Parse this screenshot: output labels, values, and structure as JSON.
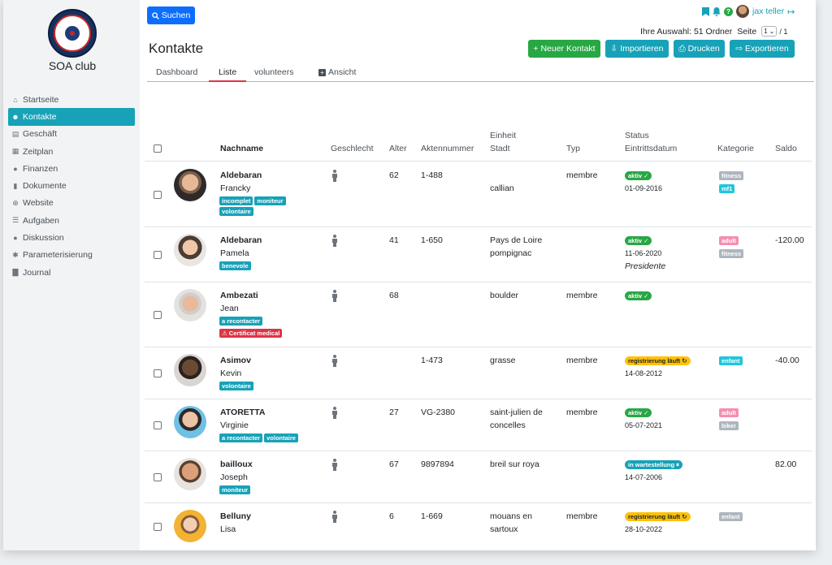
{
  "brand": {
    "name": "SOA club"
  },
  "sidebar": {
    "items": [
      {
        "label": "Startseite",
        "icon": "home-icon"
      },
      {
        "label": "Kontakte",
        "icon": "users-icon",
        "active": true
      },
      {
        "label": "Geschäft",
        "icon": "store-icon"
      },
      {
        "label": "Zeitplan",
        "icon": "calendar-icon"
      },
      {
        "label": "Finanzen",
        "icon": "piggy-bank-icon"
      },
      {
        "label": "Dokumente",
        "icon": "file-icon"
      },
      {
        "label": "Website",
        "icon": "globe-icon"
      },
      {
        "label": "Aufgaben",
        "icon": "tasks-icon"
      },
      {
        "label": "Diskussion",
        "icon": "chat-icon"
      },
      {
        "label": "Parameterisierung",
        "icon": "gear-icon"
      },
      {
        "label": "Journal",
        "icon": "book-icon"
      }
    ]
  },
  "header": {
    "search_label": "Suchen",
    "user_name": "jax teller",
    "selection_text": "Ihre Auswahl: 51 Ordner",
    "page_label": "Seite",
    "page_value": "1",
    "page_total": "/ 1",
    "title": "Kontakte"
  },
  "actions": {
    "new_label": "+ Neuer Kontakt",
    "import_label": "Importieren",
    "print_label": "Drucken",
    "export_label": "Exportieren"
  },
  "tabs": [
    {
      "label": "Dashboard"
    },
    {
      "label": "Liste",
      "active": true
    },
    {
      "label": "volunteers"
    },
    {
      "label": "Ansicht"
    }
  ],
  "table": {
    "columns": {
      "nachname": "Nachname",
      "geschlecht": "Geschlecht",
      "alter": "Alter",
      "aktennummer": "Aktennummer",
      "einheit": "Einheit",
      "stadt": "Stadt",
      "typ": "Typ",
      "status": "Status",
      "eintritt": "Eintrittsdatum",
      "kategorie": "Kategorie",
      "saldo": "Saldo"
    },
    "rows": [
      {
        "lastname": "Aldebaran",
        "firstname": "Francky",
        "tags": [
          "incomplet",
          "moniteur",
          "volontaire"
        ],
        "age": "62",
        "file": "1-488",
        "city1": "",
        "city2": "callian",
        "type": "membre",
        "status": "aktiv ✓",
        "date": "01-09-2016",
        "note": "",
        "cats": [
          "fitness",
          "mf1"
        ],
        "saldo": ""
      },
      {
        "lastname": "Aldebaran",
        "firstname": "Pamela",
        "tags": [
          "benevole"
        ],
        "age": "41",
        "file": "1-650",
        "city1": "Pays de Loire",
        "city2": "pompignac",
        "type": "",
        "status": "aktiv ✓",
        "date": "11-06-2020",
        "note": "Presidente",
        "cats": [
          "adult",
          "fitness"
        ],
        "saldo": "-120.00"
      },
      {
        "lastname": "Ambezati",
        "firstname": "Jean",
        "tags": [
          "a recontacter",
          "⚠ Certificat medical"
        ],
        "age": "68",
        "file": "",
        "city1": "boulder",
        "city2": "",
        "type": "membre",
        "status": "aktiv ✓",
        "date": "",
        "note": "",
        "cats": [],
        "saldo": ""
      },
      {
        "lastname": "Asimov",
        "firstname": "Kevin",
        "tags": [
          "volontaire"
        ],
        "age": "",
        "file": "1-473",
        "city1": "grasse",
        "city2": "",
        "type": "membre",
        "status": "registrierung läuft ↻",
        "date": "14-08-2012",
        "note": "",
        "cats": [
          "enfant"
        ],
        "saldo": "-40.00"
      },
      {
        "lastname": "ATORETTA",
        "firstname": "Virginie",
        "tags": [
          "a recontacter",
          "volontaire"
        ],
        "age": "27",
        "file": "VG-2380",
        "city1": "saint-julien de",
        "city2": "concelles",
        "type": "membre",
        "status": "aktiv ✓",
        "date": "05-07-2021",
        "note": "",
        "cats": [
          "adult",
          "biker"
        ],
        "saldo": ""
      },
      {
        "lastname": "bailloux",
        "firstname": "Joseph",
        "tags": [
          "moniteur"
        ],
        "age": "67",
        "file": "9897894",
        "city1": "breil sur roya",
        "city2": "",
        "type": "",
        "status": "in wartestellung ⏸",
        "date": "14-07-2006",
        "note": "",
        "cats": [],
        "saldo": "82.00"
      },
      {
        "lastname": "Belluny",
        "firstname": "Lisa",
        "tags": [],
        "age": "6",
        "file": "1-669",
        "city1": "mouans en",
        "city2": "sartoux",
        "type": "membre",
        "status": "registrierung läuft ↻",
        "date": "28-10-2022",
        "note": "",
        "cats": [
          "enfant"
        ],
        "saldo": ""
      }
    ]
  },
  "colors": {
    "primary": "#0d6efd",
    "info": "#17a2b8",
    "success": "#28a745",
    "danger": "#dc3545",
    "warning": "#ffc107"
  }
}
